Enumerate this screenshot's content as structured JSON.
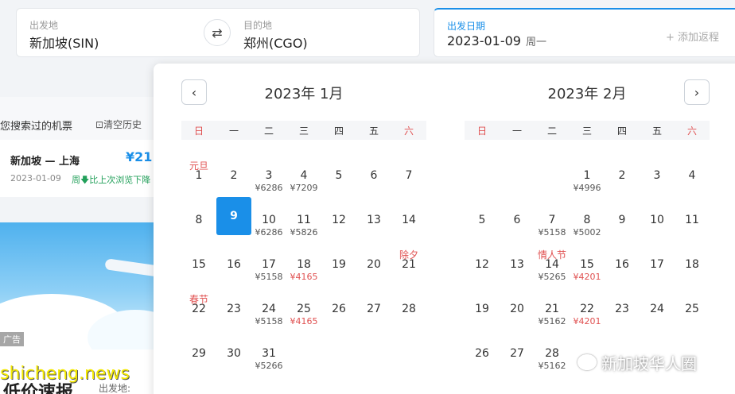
{
  "search": {
    "from_label": "出发地",
    "from_value": "新加坡(SIN)",
    "to_label": "目的地",
    "to_value": "郑州(CGO)",
    "date_label": "出发日期",
    "date_value": "2023-01-09",
    "date_weekday": "周一",
    "add_return": "+ 添加返程",
    "swap_icon": "⇄"
  },
  "history": {
    "title": "您搜索过的机票",
    "clear": "⊡清空历史",
    "card": {
      "route": "新加坡 — 上海",
      "price": "¥21",
      "date": "2023-01-09",
      "weekday": "周",
      "trend": "🡇比上次浏览下降"
    }
  },
  "ad": {
    "tag": "广告",
    "promo_title": "低价速报",
    "promo_from": "出发地:"
  },
  "calendar": {
    "prev_icon": "‹",
    "next_icon": "›",
    "weekdays": [
      "日",
      "一",
      "二",
      "三",
      "四",
      "五",
      "六"
    ],
    "months": [
      {
        "title": "2023年 1月",
        "first_weekday": 0,
        "days": [
          {
            "d": "1",
            "holiday": "元旦"
          },
          {
            "d": "2"
          },
          {
            "d": "3",
            "price": "¥6286"
          },
          {
            "d": "4",
            "price": "¥7209"
          },
          {
            "d": "5"
          },
          {
            "d": "6"
          },
          {
            "d": "7"
          },
          {
            "d": "8"
          },
          {
            "d": "9",
            "selected": true
          },
          {
            "d": "10",
            "price": "¥6286"
          },
          {
            "d": "11",
            "price": "¥5826"
          },
          {
            "d": "12"
          },
          {
            "d": "13"
          },
          {
            "d": "14"
          },
          {
            "d": "15"
          },
          {
            "d": "16"
          },
          {
            "d": "17",
            "price": "¥5158"
          },
          {
            "d": "18",
            "price": "¥4165",
            "low": true
          },
          {
            "d": "19"
          },
          {
            "d": "20"
          },
          {
            "d": "21",
            "holiday": "除夕"
          },
          {
            "d": "22",
            "holiday": "春节"
          },
          {
            "d": "23"
          },
          {
            "d": "24",
            "price": "¥5158"
          },
          {
            "d": "25",
            "price": "¥4165",
            "low": true
          },
          {
            "d": "26"
          },
          {
            "d": "27"
          },
          {
            "d": "28"
          },
          {
            "d": "29"
          },
          {
            "d": "30"
          },
          {
            "d": "31",
            "price": "¥5266"
          }
        ]
      },
      {
        "title": "2023年 2月",
        "first_weekday": 3,
        "days": [
          {
            "d": "1",
            "price": "¥4996"
          },
          {
            "d": "2"
          },
          {
            "d": "3"
          },
          {
            "d": "4"
          },
          {
            "d": "5"
          },
          {
            "d": "6"
          },
          {
            "d": "7",
            "price": "¥5158"
          },
          {
            "d": "8",
            "price": "¥5002"
          },
          {
            "d": "9"
          },
          {
            "d": "10"
          },
          {
            "d": "11"
          },
          {
            "d": "12"
          },
          {
            "d": "13"
          },
          {
            "d": "14",
            "holiday": "情人节",
            "price": "¥5265"
          },
          {
            "d": "15",
            "price": "¥4201",
            "low": true
          },
          {
            "d": "16"
          },
          {
            "d": "17"
          },
          {
            "d": "18"
          },
          {
            "d": "19"
          },
          {
            "d": "20"
          },
          {
            "d": "21",
            "price": "¥5162"
          },
          {
            "d": "22",
            "price": "¥4201",
            "low": true
          },
          {
            "d": "23"
          },
          {
            "d": "24"
          },
          {
            "d": "25"
          },
          {
            "d": "26"
          },
          {
            "d": "27"
          },
          {
            "d": "28",
            "price": "¥5162"
          }
        ]
      }
    ]
  },
  "watermarks": {
    "left": "shicheng.news",
    "right": "新加坡华人圈"
  },
  "colors": {
    "accent": "#1a8fe8",
    "holiday": "#e05050",
    "low_price": "#e05050"
  }
}
